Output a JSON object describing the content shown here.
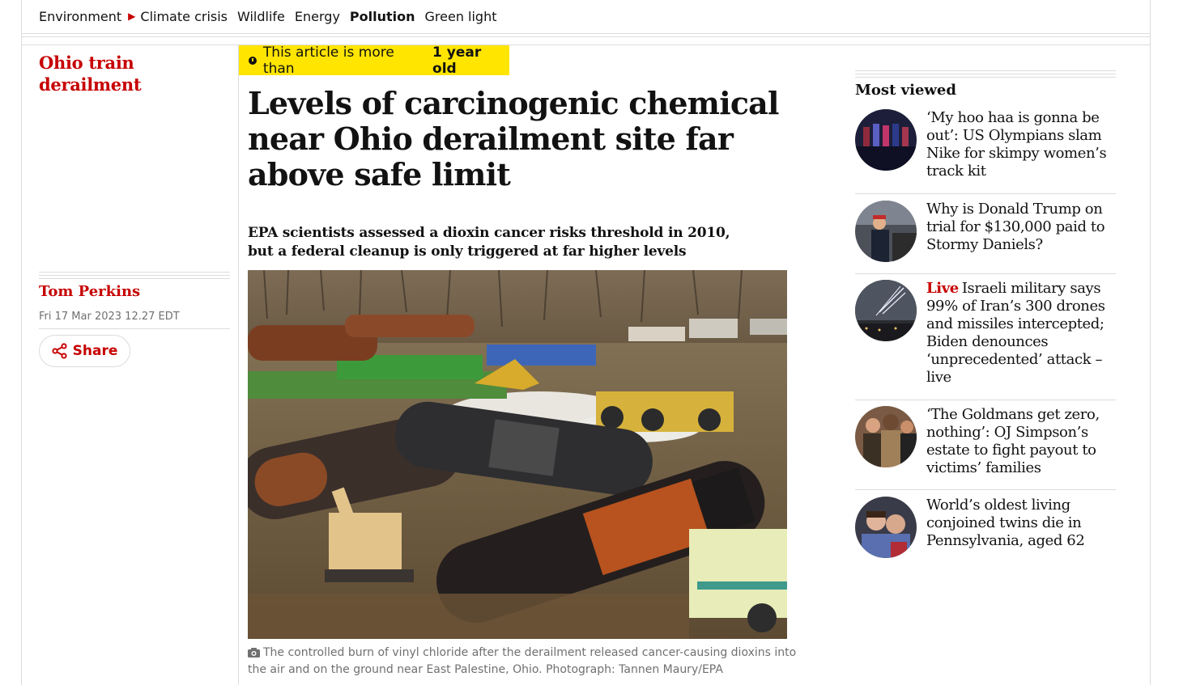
{
  "subnav": {
    "items": [
      "Environment",
      "Climate crisis",
      "Wildlife",
      "Energy",
      "Pollution",
      "Green light"
    ],
    "active": "Pollution"
  },
  "article": {
    "series": "Ohio train derailment",
    "badge_prefix": "This article is more than",
    "badge_age": "1 year old",
    "headline": "Levels of carcinogenic chemical near Ohio derailment site far above safe limit",
    "standfirst": "EPA scientists assessed a dioxin cancer risks threshold in 2010, but a federal cleanup is only triggered at far higher levels",
    "author": "Tom Perkins",
    "date": "Fri 17 Mar 2023 12.27 EDT",
    "share_label": "Share",
    "caption": "The controlled burn of vinyl chloride after the derailment released cancer-causing dioxins into the air and on the ground near East Palestine, Ohio. Photograph: Tannen Maury/EPA"
  },
  "most_viewed": {
    "title": "Most viewed",
    "items": [
      {
        "live": "",
        "text": "‘My hoo haa is gonna be out’: US Olympians slam Nike for skimpy women’s track kit"
      },
      {
        "live": "",
        "text": "Why is Donald Trump on trial for $130,000 paid to Stormy Daniels?"
      },
      {
        "live": "Live",
        "text": "Israeli military says 99% of Iran’s 300 drones and missiles intercepted; Biden denounces ‘unprecedented’ attack – live"
      },
      {
        "live": "",
        "text": "‘The Goldmans get zero, nothing’: OJ Simpson’s estate to fight payout to victims’ families"
      },
      {
        "live": "",
        "text": "World’s oldest living conjoined twins die in Pennsylvania, aged 62"
      }
    ]
  },
  "colors": {
    "brand_red": "#c70000",
    "badge_yellow": "#ffe500",
    "text": "#121212",
    "muted": "#707070"
  },
  "icons": {
    "nav_arrow": "play-arrow-icon",
    "clock": "clock-icon",
    "share": "share-icon",
    "camera": "camera-icon"
  }
}
